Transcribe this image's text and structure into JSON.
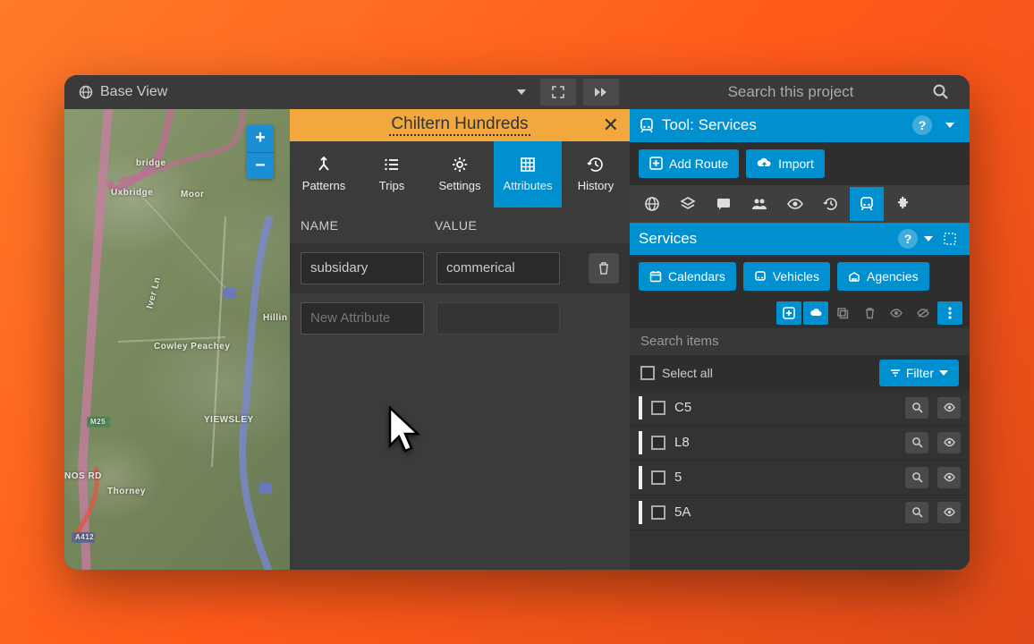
{
  "topbar": {
    "view_label": "Base View",
    "search_placeholder": "Search this project"
  },
  "map": {
    "labels": [
      "bridge",
      "Uxbridge",
      "Moor",
      "Iver Ln",
      "Hillin",
      "Cowley Peachey",
      "YIEWSLEY",
      "Thorney",
      "NOS RD",
      "M25",
      "A412"
    ]
  },
  "detail": {
    "title": "Chiltern Hundreds",
    "tabs": {
      "patterns": "Patterns",
      "trips": "Trips",
      "settings": "Settings",
      "attributes": "Attributes",
      "history": "History"
    },
    "attr_header": {
      "name": "NAME",
      "value": "VALUE"
    },
    "rows": [
      {
        "name": "subsidary",
        "value": "commerical"
      }
    ],
    "new_attr_placeholder": "New Attribute"
  },
  "side": {
    "tool_title": "Tool: Services",
    "add_route": "Add Route",
    "import": "Import",
    "services_title": "Services",
    "sub_pills": {
      "calendars": "Calendars",
      "vehicles": "Vehicles",
      "agencies": "Agencies"
    },
    "search_items_placeholder": "Search items",
    "select_all": "Select all",
    "filter": "Filter",
    "items": [
      {
        "name": "C5"
      },
      {
        "name": "L8"
      },
      {
        "name": "5"
      },
      {
        "name": "5A"
      }
    ]
  }
}
